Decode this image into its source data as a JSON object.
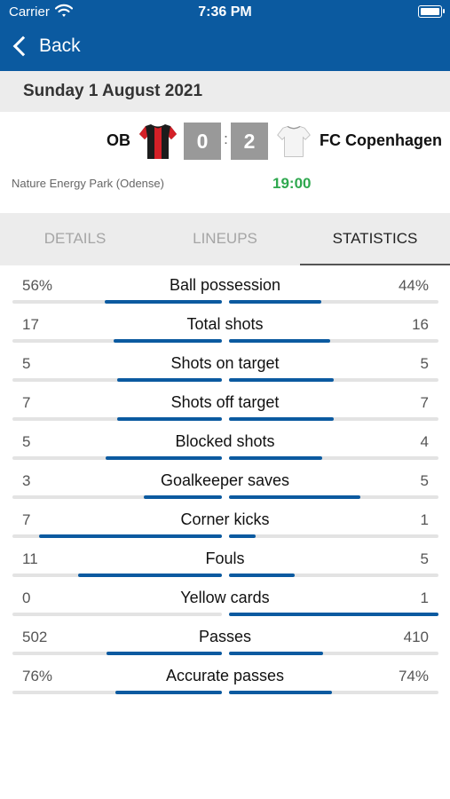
{
  "status_bar": {
    "carrier": "Carrier",
    "time": "7:36 PM"
  },
  "nav": {
    "back_label": "Back"
  },
  "match": {
    "date": "Sunday 1 August 2021",
    "home_team": "OB",
    "away_team": "FC Copenhagen",
    "home_score": "0",
    "away_score": "2",
    "score_separator": ":",
    "venue": "Nature Energy Park (Odense)",
    "kickoff": "19:00"
  },
  "tabs": [
    {
      "label": "DETAILS",
      "active": false
    },
    {
      "label": "LINEUPS",
      "active": false
    },
    {
      "label": "STATISTICS",
      "active": true
    }
  ],
  "stats": [
    {
      "label": "Ball possession",
      "home": "56%",
      "away": "44%",
      "home_val": 56,
      "away_val": 44
    },
    {
      "label": "Total shots",
      "home": "17",
      "away": "16",
      "home_val": 17,
      "away_val": 16
    },
    {
      "label": "Shots on target",
      "home": "5",
      "away": "5",
      "home_val": 5,
      "away_val": 5
    },
    {
      "label": "Shots off target",
      "home": "7",
      "away": "7",
      "home_val": 7,
      "away_val": 7
    },
    {
      "label": "Blocked shots",
      "home": "5",
      "away": "4",
      "home_val": 5,
      "away_val": 4
    },
    {
      "label": "Goalkeeper saves",
      "home": "3",
      "away": "5",
      "home_val": 3,
      "away_val": 5
    },
    {
      "label": "Corner kicks",
      "home": "7",
      "away": "1",
      "home_val": 7,
      "away_val": 1
    },
    {
      "label": "Fouls",
      "home": "11",
      "away": "5",
      "home_val": 11,
      "away_val": 5
    },
    {
      "label": "Yellow cards",
      "home": "0",
      "away": "1",
      "home_val": 0,
      "away_val": 1
    },
    {
      "label": "Passes",
      "home": "502",
      "away": "410",
      "home_val": 502,
      "away_val": 410
    },
    {
      "label": "Accurate passes",
      "home": "76%",
      "away": "74%",
      "home_val": 76,
      "away_val": 74
    }
  ],
  "colors": {
    "header": "#0b5aa0",
    "bar_fill": "#0b5aa0",
    "kickoff": "#2fa84f",
    "score_box": "#999999"
  }
}
